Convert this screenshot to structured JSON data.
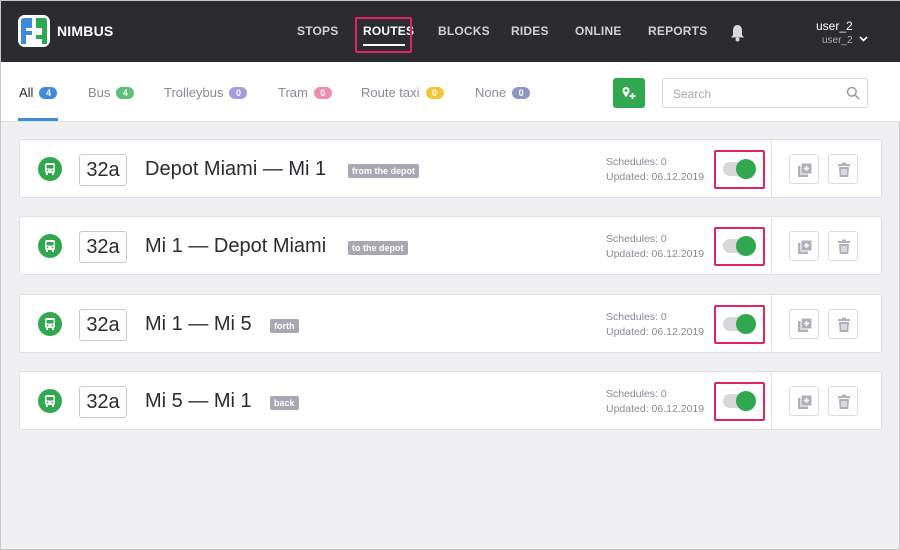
{
  "app": {
    "brand": "NIMBUS"
  },
  "nav": {
    "items": [
      {
        "label": "STOPS"
      },
      {
        "label": "ROUTES",
        "active": true
      },
      {
        "label": "BLOCKS"
      },
      {
        "label": "RIDES"
      },
      {
        "label": "ONLINE"
      },
      {
        "label": "REPORTS"
      }
    ]
  },
  "user": {
    "name": "user_2",
    "login": "user_2"
  },
  "filters": {
    "tabs": [
      {
        "label": "All",
        "count": "4",
        "color": "#3d8bd9",
        "active": true
      },
      {
        "label": "Bus",
        "count": "4",
        "color": "#5cbf7a"
      },
      {
        "label": "Trolleybus",
        "count": "0",
        "color": "#a99be0"
      },
      {
        "label": "Tram",
        "count": "0",
        "color": "#ef8cb0"
      },
      {
        "label": "Route taxi",
        "count": "0",
        "color": "#f2c53d"
      },
      {
        "label": "None",
        "count": "0",
        "color": "#8a98c4"
      }
    ]
  },
  "search": {
    "placeholder": "Search",
    "value": ""
  },
  "colors": {
    "accent": "#2fa84f",
    "highlight": "#e0245e",
    "header": "#2b2b30"
  },
  "routes": [
    {
      "number": "32a",
      "name": "Depot Miami — Mi 1",
      "tag": "from the depot",
      "schedules": "Schedules: 0",
      "updated": "Updated: 06.12.2019",
      "enabled": true
    },
    {
      "number": "32a",
      "name": "Mi 1 — Depot Miami",
      "tag": "to the depot",
      "schedules": "Schedules: 0",
      "updated": "Updated: 06.12.2019",
      "enabled": true
    },
    {
      "number": "32a",
      "name": "Mi 1 — Mi 5",
      "tag": "forth",
      "schedules": "Schedules: 0",
      "updated": "Updated: 06.12.2019",
      "enabled": true
    },
    {
      "number": "32a",
      "name": "Mi 5 — Mi 1",
      "tag": "back",
      "schedules": "Schedules: 0",
      "updated": "Updated: 06.12.2019",
      "enabled": true
    }
  ]
}
